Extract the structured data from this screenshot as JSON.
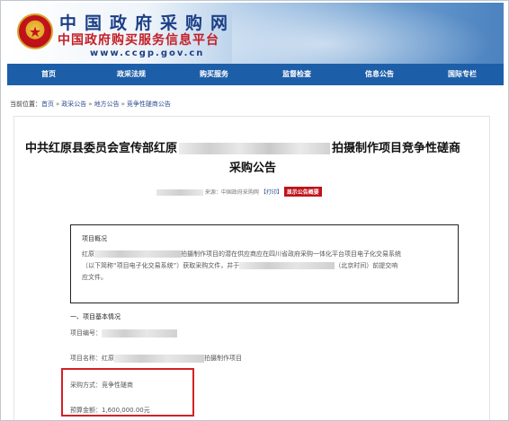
{
  "header": {
    "logo_cn_main": "中国政府采购网",
    "logo_cn_sub": "中国政府购买服务信息平台",
    "logo_url": "www.ccgp.gov.cn"
  },
  "nav": {
    "items": [
      {
        "label": "首页"
      },
      {
        "label": "政采法规"
      },
      {
        "label": "购买服务"
      },
      {
        "label": "监督检查"
      },
      {
        "label": "信息公告"
      },
      {
        "label": "国际专栏"
      }
    ]
  },
  "breadcrumb": {
    "prefix": "当前位置：",
    "items": [
      "首页",
      "政采公告",
      "地方公告",
      "竞争性磋商公告"
    ]
  },
  "article": {
    "title_part1": "中共红原县委员会宣传部红原",
    "title_part2": "拍摄制作项目竞争性磋商",
    "title_line2": "采购公告",
    "meta_source": "来源：中国政府采购网",
    "meta_print": "【打印】",
    "meta_badge": "显示公告概要",
    "overview": {
      "heading": "项目概况",
      "text_a": "红原",
      "text_b": "拍摄制作项目的潜在供应商应在四川省政府采购一体化平台项目电子化交易系统",
      "text_c": "（以下简称“项目电子化交易系统”）获取采购文件，并于",
      "text_d": "（北京时间）前提交响",
      "text_e": "应文件。"
    },
    "section1": "一、项目基本情况",
    "project_no_label": "项目编号：",
    "project_name_label": "项目名称：红原",
    "project_name_suffix": "拍摄制作项目",
    "procurement_method": "采购方式：竞争性磋商",
    "budget": "预算金额：1,600,000.00元"
  }
}
